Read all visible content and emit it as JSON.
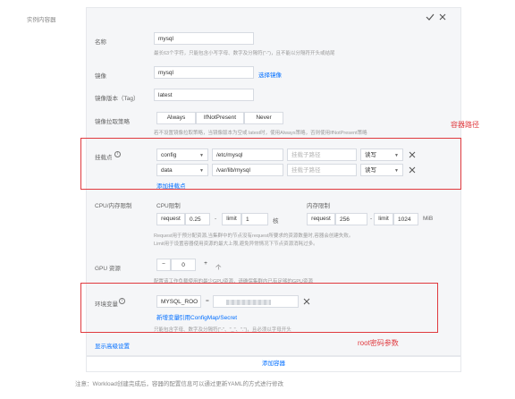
{
  "section_label": "实例内容器",
  "header_actions": {
    "confirm_icon": "check-icon",
    "close_icon": "close-icon"
  },
  "name": {
    "label": "名称",
    "value": "mysql",
    "hint": "最长63个字符，只能包含小写字母、数字及分隔符(\"-\")，且不能以分隔符开头或结尾"
  },
  "image": {
    "label": "镜像",
    "value": "mysql",
    "select_link": "选择镜像"
  },
  "image_tag": {
    "label": "镜像版本（Tag）",
    "value": "latest"
  },
  "pull_policy": {
    "label": "镜像拉取策略",
    "options": [
      "Always",
      "IfNotPresent",
      "Never"
    ],
    "hint": "若不设置镜像拉取策略，当镜像版本为空或 latest时，使用Always策略，否则使用IfNotPresent策略"
  },
  "mounts": {
    "label": "挂载点",
    "rows": [
      {
        "volume": "config",
        "path": "/etc/mysql",
        "subpath_placeholder": "挂载子路径",
        "mode": "读写"
      },
      {
        "volume": "data",
        "path": "/var/lib/mysql",
        "subpath_placeholder": "挂载子路径",
        "mode": "读写"
      }
    ],
    "add_link": "添加挂载点"
  },
  "resources": {
    "label": "CPU/内存限制",
    "cpu_title": "CPU限制",
    "mem_title": "内存限制",
    "request_label": "request",
    "limit_label": "limit",
    "cpu_request": "0.25",
    "cpu_limit": "1",
    "cpu_unit": "核",
    "mem_request": "256",
    "mem_limit": "1024",
    "mem_unit": "MiB",
    "dash": "-",
    "hint_1": "Request用于预分配资源,当集群中的节点没有request所要求的资源数量时,容器会创建失败。",
    "hint_2": "Limit用于设置容器使用资源的最大上限,避免异常情况下节点资源消耗过多。"
  },
  "gpu": {
    "label": "GPU 资源",
    "minus": "−",
    "value": "0",
    "plus": "+",
    "unit": "个",
    "hint": "配置该工作负载使用的最少GPU资源，请确保集群内已有足够的GPU资源"
  },
  "env": {
    "label": "环境变量",
    "key": "MYSQL_ROO",
    "eq": "=",
    "add_link": "新增变量",
    "ref_link": "引用ConfigMap/Secret",
    "hint": "只能包含字母、数字及分隔符(\"-\"、\"_\"、\".\")，且必须以字母开头"
  },
  "advanced_link": "显示高级设置",
  "add_container": "添加容器",
  "footer": "注意：Workload创建完成后，容器的配置信息可以通过更新YAML的方式进行修改",
  "annotations": {
    "mount_path": "容器路径",
    "root_password": "root密码参数"
  }
}
